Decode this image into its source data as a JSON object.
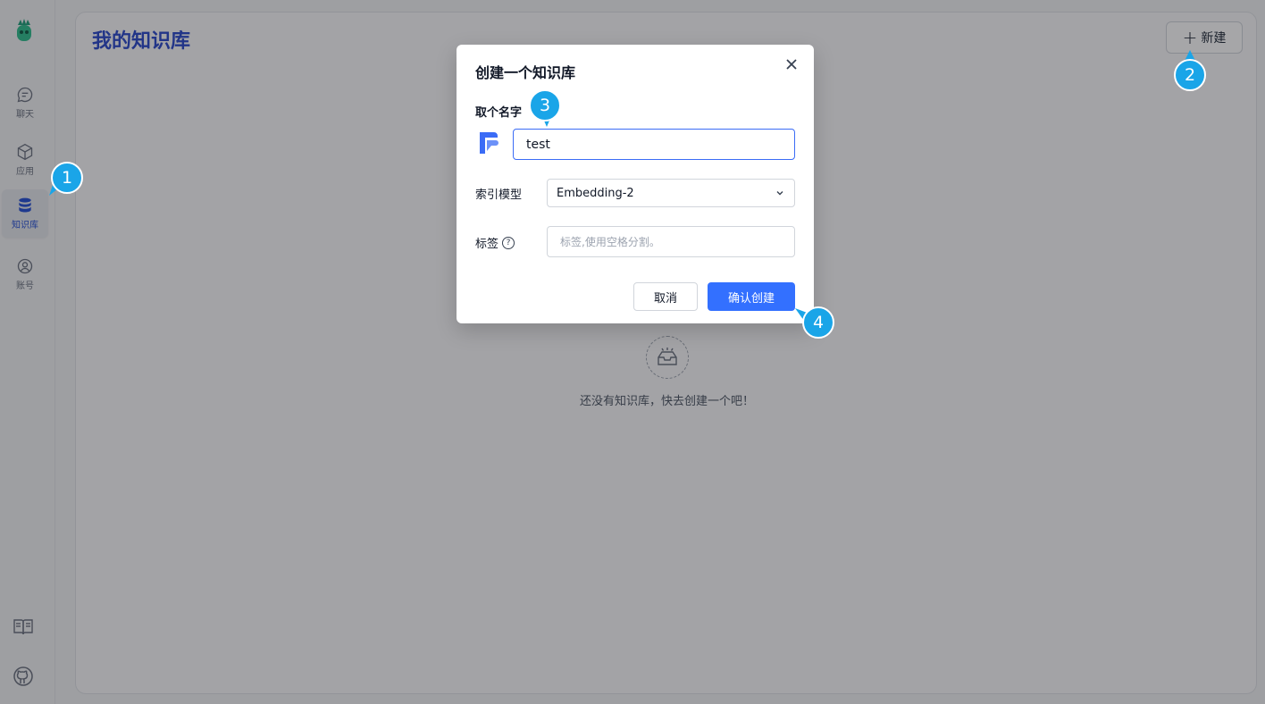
{
  "sidebar": {
    "items": [
      {
        "label": "聊天",
        "icon": "chat-icon"
      },
      {
        "label": "应用",
        "icon": "cube-icon"
      },
      {
        "label": "知识库",
        "icon": "database-icon"
      },
      {
        "label": "账号",
        "icon": "user-icon"
      }
    ],
    "bottom_icons": [
      "book-icon",
      "github-icon"
    ]
  },
  "main": {
    "title": "我的知识库",
    "new_button_label": "新建",
    "empty_text": "还没有知识库，快去创建一个吧！"
  },
  "modal": {
    "title": "创建一个知识库",
    "name_label": "取个名字",
    "name_value": "test",
    "model_label": "索引模型",
    "model_value": "Embedding-2",
    "tag_label": "标签",
    "tag_placeholder": "标签,使用空格分割。",
    "cancel_label": "取消",
    "confirm_label": "确认创建"
  },
  "markers": [
    "1",
    "2",
    "3",
    "4"
  ],
  "colors": {
    "accent": "#3370ff",
    "marker": "#1aa5e8",
    "title": "#2b4acb"
  }
}
